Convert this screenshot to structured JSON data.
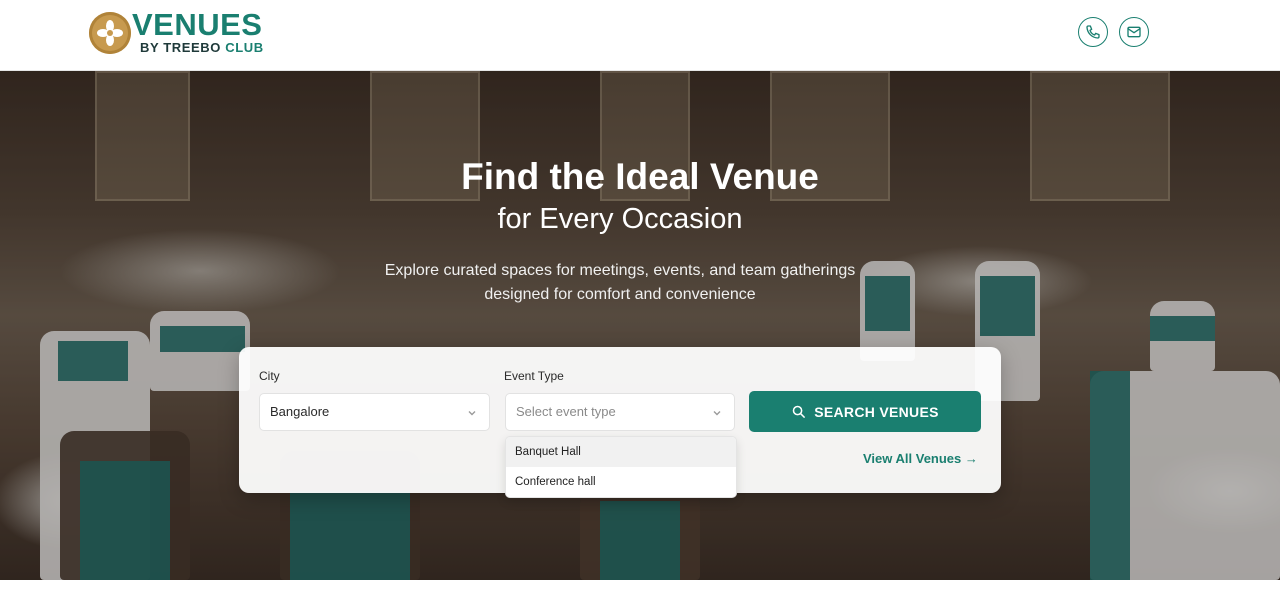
{
  "brand": {
    "name": "VENUES",
    "sub_prefix": "BY TREEBO",
    "sub_club": "CLUB",
    "color_primary": "#1a7f70",
    "color_logo_mark": "#c79a4f"
  },
  "header": {
    "phone_icon": "phone-icon",
    "mail_icon": "mail-icon"
  },
  "hero": {
    "title": "Find the Ideal Venue",
    "subtitle": "for Every Occasion",
    "description_line1": "Explore curated spaces for meetings, events, and team gatherings",
    "description_line2": "designed for comfort and convenience"
  },
  "search": {
    "city_label": "City",
    "city_value": "Bangalore",
    "event_label": "Event Type",
    "event_placeholder": "Select event type",
    "event_options": [
      "Banquet Hall",
      "Conference hall"
    ],
    "search_button": "SEARCH VENUES",
    "view_all": "View All Venues →"
  }
}
